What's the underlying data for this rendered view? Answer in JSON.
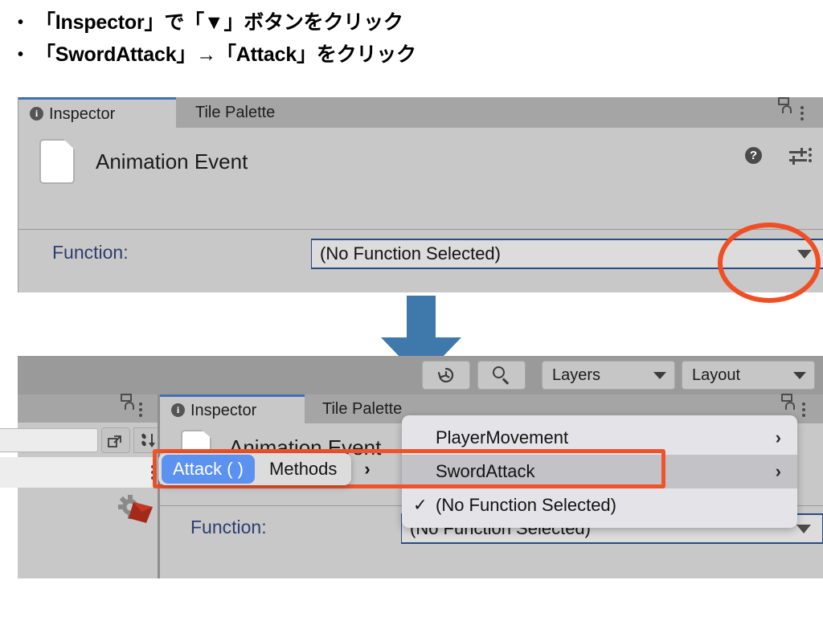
{
  "instructions": {
    "line1": "「Inspector」で「▼」ボタンをクリック",
    "line2": "「SwordAttack」→「Attack」をクリック",
    "bullet": "•"
  },
  "top_panel": {
    "tabs": [
      {
        "label": "Inspector",
        "icon": "info-icon",
        "active": true
      },
      {
        "label": "Tile Palette",
        "icon": "",
        "active": false
      }
    ],
    "header_icons": {
      "lock": "lock-icon",
      "menu": "kebab-icon",
      "help": "?",
      "settings": "sliders-icon"
    },
    "object_title": "Animation Event",
    "object_icon": "document-icon",
    "function_label": "Function:",
    "function_value": "(No Function Selected)",
    "dropdown_caret": "caret-down-icon"
  },
  "arrow": {
    "name": "down-arrow",
    "color": "#3f79ab"
  },
  "toolbar": {
    "buttons": [
      {
        "label": "",
        "icon": "history-icon",
        "caret": false
      },
      {
        "label": "",
        "icon": "search-icon",
        "caret": false
      },
      {
        "label": "Layers",
        "icon": "",
        "caret": true
      },
      {
        "label": "Layout",
        "icon": "",
        "caret": true
      }
    ]
  },
  "bottom_panel": {
    "tabs": [
      {
        "label": "Inspector",
        "icon": "info-icon",
        "active": true
      },
      {
        "label": "Tile Palette",
        "icon": "",
        "active": false
      }
    ],
    "object_title": "Animation Event",
    "function_label": "Function:",
    "function_value": "(No Function Selected)",
    "dropdown_caret": "caret-down-icon",
    "left_strip": {
      "lock": "lock-icon",
      "menu": "kebab-icon",
      "search_value": "",
      "expand_icon": "expand-window-icon",
      "sort_icon": "sort-icon",
      "row_menu": "kebab-icon",
      "asset_icon": "gear-asset-icon"
    }
  },
  "popup_menu": {
    "items": [
      {
        "label": "PlayerMovement",
        "chevron": "›",
        "checked": false,
        "highlighted": false
      },
      {
        "label": "SwordAttack",
        "chevron": "›",
        "checked": false,
        "highlighted": true
      },
      {
        "label": "(No Function Selected)",
        "chevron": "",
        "checked": true,
        "highlighted": false
      }
    ],
    "check_glyph": "✓"
  },
  "submenu": {
    "selected_label": "Attack ( )",
    "parent_label": "Methods",
    "chevron": "›"
  },
  "colors": {
    "annotation": "#f0522b",
    "accent_blue": "#5b92f0",
    "panel_bg": "#c8c8c8",
    "tabbar_bg": "#a5a5a5",
    "arrow_blue": "#3f79ab",
    "field_border": "#2a4a80",
    "label_blue": "#2c3e70"
  }
}
